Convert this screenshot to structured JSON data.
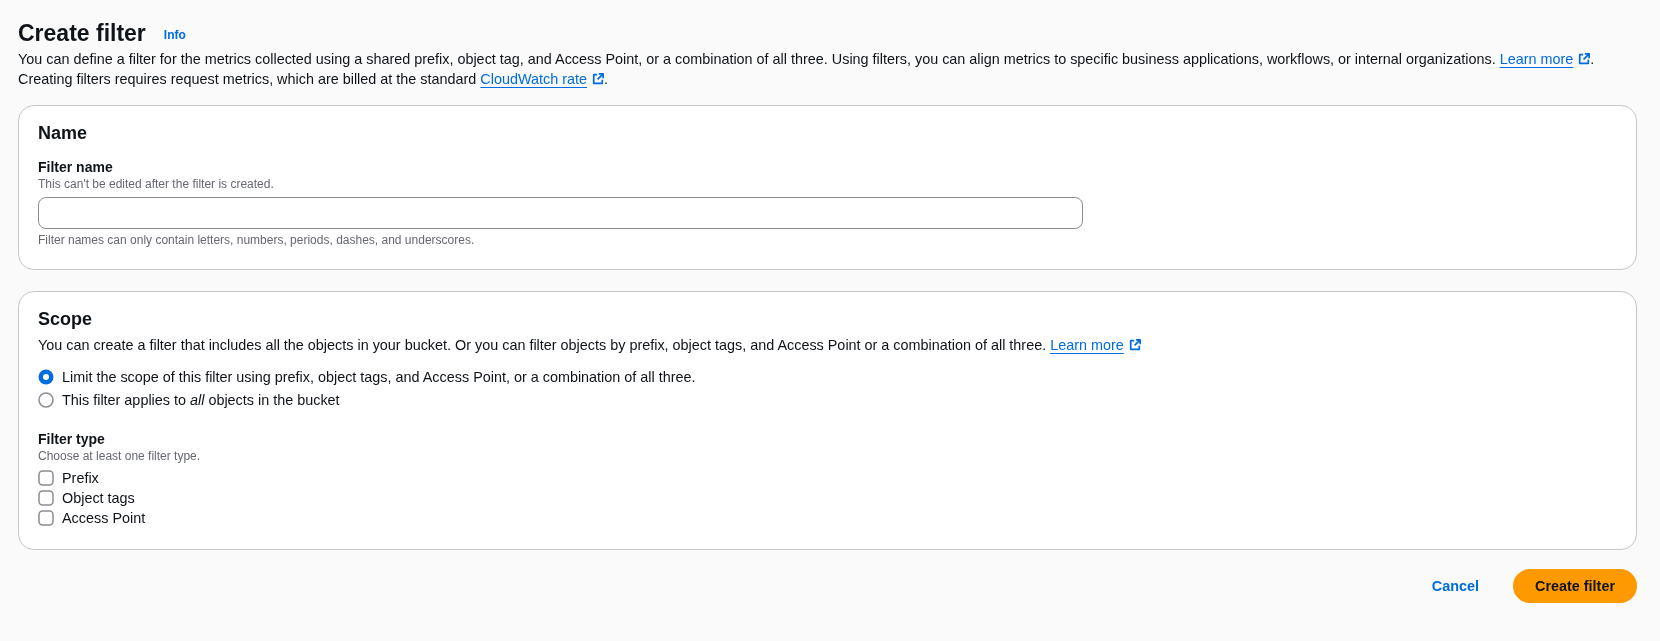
{
  "page": {
    "title": "Create filter",
    "info_link": "Info",
    "description": [
      [
        {
          "kind": "text",
          "text": "You can define a filter for the metrics collected using a shared prefix, object tag, and Access Point, or a combination of all three. Using filters, you can align metrics to specific business applications, workflows, or internal organizations. "
        },
        {
          "kind": "link",
          "text": "Learn more",
          "external": true
        },
        {
          "kind": "text",
          "text": "."
        }
      ],
      [
        {
          "kind": "text",
          "text": "Creating filters requires request metrics, which are billed at the standard "
        },
        {
          "kind": "link",
          "text": "CloudWatch rate",
          "external": true
        },
        {
          "kind": "text",
          "text": "."
        }
      ]
    ]
  },
  "name_section": {
    "heading": "Name",
    "field": {
      "label": "Filter name",
      "description": "This can't be edited after the filter is created.",
      "constraint": "Filter names can only contain letters, numbers, periods, dashes, and underscores."
    }
  },
  "scope_section": {
    "heading": "Scope",
    "description": [
      {
        "kind": "text",
        "text": "You can create a filter that includes all the objects in your bucket. Or you can filter objects by prefix, object tags, and Access Point or a combination of all three. "
      },
      {
        "kind": "link",
        "text": "Learn more",
        "external": true
      }
    ],
    "options": [
      {
        "label": "Limit the scope of this filter using prefix, object tags, and Access Point, or a combination of all three.",
        "selected": true
      },
      {
        "label": "This filter applies to *all* objects in the bucket",
        "selected": false
      }
    ],
    "filter_type": {
      "label": "Filter type",
      "description": "Choose at least one filter type.",
      "options": [
        {
          "label": "Prefix",
          "checked": false
        },
        {
          "label": "Object tags",
          "checked": false
        },
        {
          "label": "Access Point",
          "checked": false
        }
      ]
    }
  },
  "buttons": [
    {
      "label": "Cancel",
      "kind": "link"
    },
    {
      "label": "Create filter",
      "kind": "primary"
    }
  ]
}
